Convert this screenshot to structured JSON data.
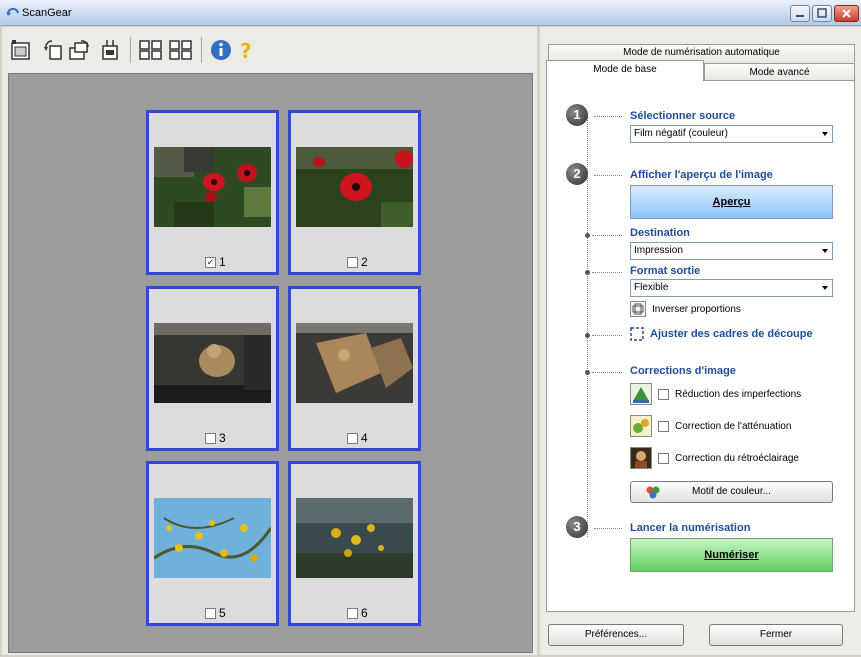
{
  "window": {
    "title": "ScanGear"
  },
  "toolbar": {
    "buttons": [
      {
        "name": "thumbnail-view-icon"
      },
      {
        "name": "rotate-left-icon"
      },
      {
        "name": "rotate-right-icon"
      },
      {
        "name": "auto-crop-icon"
      },
      {
        "name": "grid-view-icon"
      },
      {
        "name": "grid-view-alt-icon"
      },
      {
        "name": "info-icon"
      },
      {
        "name": "help-icon"
      }
    ]
  },
  "frames": [
    {
      "number": "1",
      "checked": true,
      "checkmark": "✓"
    },
    {
      "number": "2",
      "checked": false,
      "checkmark": ""
    },
    {
      "number": "3",
      "checked": false,
      "checkmark": ""
    },
    {
      "number": "4",
      "checked": false,
      "checkmark": ""
    },
    {
      "number": "5",
      "checked": false,
      "checkmark": ""
    },
    {
      "number": "6",
      "checked": false,
      "checkmark": ""
    }
  ],
  "tabs": {
    "auto": "Mode de numérisation automatique",
    "basic": "Mode de base",
    "advanced": "Mode avancé"
  },
  "steps": {
    "step1_number": "1",
    "step2_number": "2",
    "step3_number": "3",
    "select_source": {
      "heading": "Sélectionner source",
      "value": "Film négatif (couleur)"
    },
    "preview": {
      "heading": "Afficher l'aperçu de l'image",
      "button": "Aperçu"
    },
    "destination": {
      "heading": "Destination",
      "value": "Impression"
    },
    "output_size": {
      "heading": "Format sortie",
      "value": "Flexible",
      "invert_label": "Inverser proportions"
    },
    "crop": {
      "label": "Ajuster des cadres de découpe"
    },
    "corrections": {
      "heading": "Corrections d'image",
      "items": [
        {
          "label": "Réduction des imperfections"
        },
        {
          "label": "Correction de l'atténuation"
        },
        {
          "label": "Correction du rétroéclairage"
        }
      ],
      "color_pattern": "Motif de couleur..."
    },
    "scan": {
      "heading": "Lancer la numérisation",
      "button": "Numériser"
    }
  },
  "footer": {
    "preferences": "Préférences...",
    "close": "Fermer"
  },
  "colors": {
    "frame_border": "#3347d6",
    "heading": "#1f4d9a",
    "preview_button": "#8ec4f5",
    "scan_button": "#5fd062"
  }
}
